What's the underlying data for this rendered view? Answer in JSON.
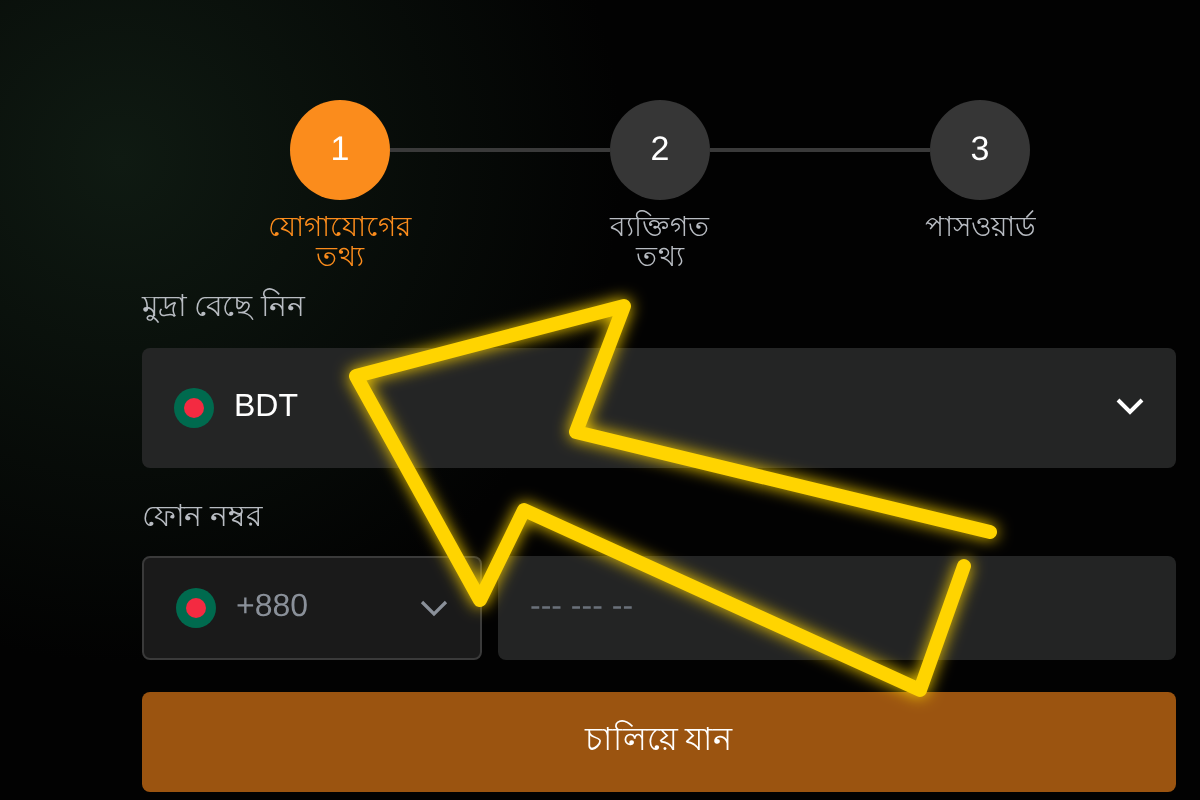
{
  "steps": [
    {
      "number": "1",
      "label": "যোগাযোগের তথ্য",
      "selected": true
    },
    {
      "number": "2",
      "label": "ব্যক্তিগত তথ্য",
      "selected": false
    },
    {
      "number": "3",
      "label": "পাসওয়ার্ড",
      "selected": false
    }
  ],
  "currency": {
    "label": "মুদ্রা বেছে নিন",
    "value": "BDT"
  },
  "phone": {
    "label": "ফোন নম্বর",
    "code": "+880",
    "placeholder": "--- --- --"
  },
  "submit": "চালিয়ে যান"
}
